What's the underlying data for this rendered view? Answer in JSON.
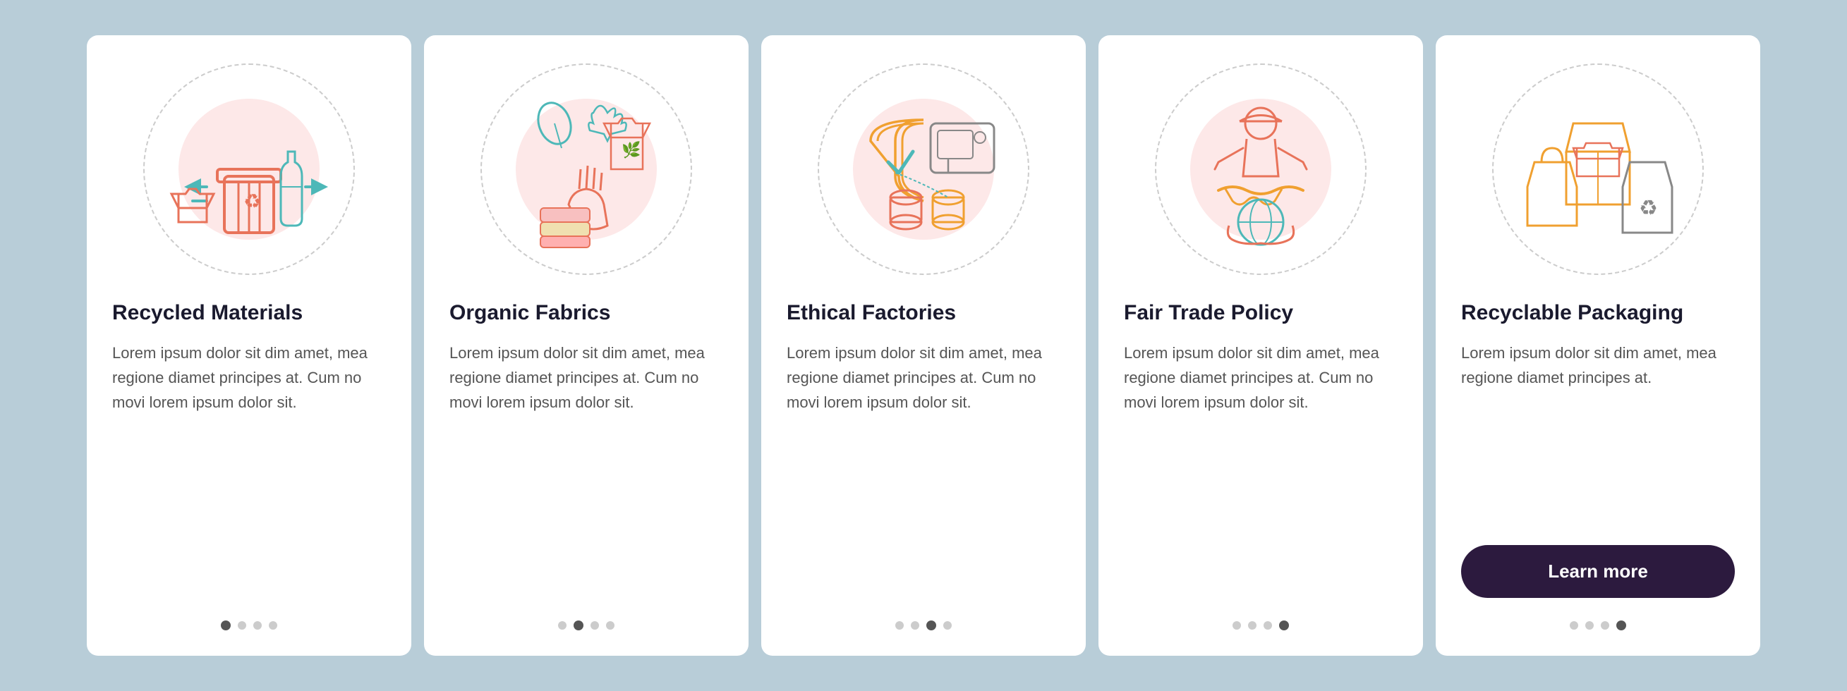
{
  "background": "#b8cdd8",
  "cards": [
    {
      "id": "recycled-materials",
      "title": "Recycled Materials",
      "body": "Lorem ipsum dolor sit dim amet, mea regione diamet principes at. Cum no movi lorem ipsum dolor sit.",
      "dots": [
        true,
        false,
        false,
        false
      ],
      "active_dot": 0,
      "show_button": false,
      "button_label": "",
      "icon_name": "recycled-materials-icon"
    },
    {
      "id": "organic-fabrics",
      "title": "Organic Fabrics",
      "body": "Lorem ipsum dolor sit dim amet, mea regione diamet principes at. Cum no movi lorem ipsum dolor sit.",
      "dots": [
        false,
        true,
        false,
        false
      ],
      "active_dot": 1,
      "show_button": false,
      "button_label": "",
      "icon_name": "organic-fabrics-icon"
    },
    {
      "id": "ethical-factories",
      "title": "Ethical Factories",
      "body": "Lorem ipsum dolor sit dim amet, mea regione diamet principes at. Cum no movi lorem ipsum dolor sit.",
      "dots": [
        false,
        false,
        true,
        false
      ],
      "active_dot": 2,
      "show_button": false,
      "button_label": "",
      "icon_name": "ethical-factories-icon"
    },
    {
      "id": "fair-trade-policy",
      "title": "Fair Trade Policy",
      "body": "Lorem ipsum dolor sit dim amet, mea regione diamet principes at. Cum no movi lorem ipsum dolor sit.",
      "dots": [
        false,
        false,
        false,
        true
      ],
      "active_dot": 3,
      "show_button": false,
      "button_label": "",
      "icon_name": "fair-trade-policy-icon"
    },
    {
      "id": "recyclable-packaging",
      "title": "Recyclable Packaging",
      "body": "Lorem ipsum dolor sit dim amet, mea regione diamet principes at.",
      "dots": [
        false,
        false,
        false,
        true
      ],
      "active_dot": 3,
      "show_button": true,
      "button_label": "Learn more",
      "icon_name": "recyclable-packaging-icon"
    }
  ]
}
